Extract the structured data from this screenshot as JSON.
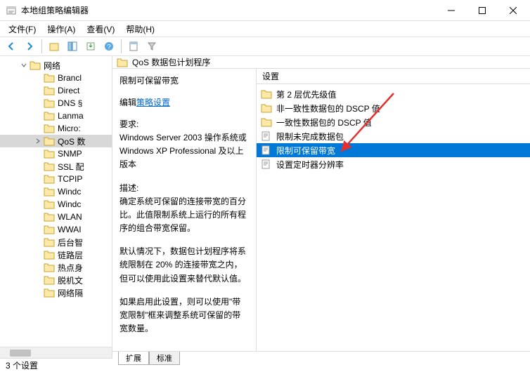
{
  "window": {
    "title": "本地组策略编辑器"
  },
  "menus": {
    "file": "文件(F)",
    "action": "操作(A)",
    "view": "查看(V)",
    "help": "帮助(H)"
  },
  "tree": {
    "root": "网络",
    "items": [
      "Brancl",
      "Direct",
      "DNS §",
      "Lanma",
      "Micro:",
      "QoS 数",
      "SNMP",
      "SSL 配",
      "TCPIP",
      "Windc",
      "Windc",
      "WLAN",
      "WWAI",
      "后台智",
      "链路层",
      "热点身",
      "脱机文",
      "网络隔"
    ],
    "selected_index": 5
  },
  "path": {
    "text": "QoS 数据包计划程序"
  },
  "description": {
    "setting_name": "限制可保留带宽",
    "edit_prefix": "编辑",
    "edit_link": "策略设置",
    "req_label": "要求:",
    "req_text": "Windows Server 2003 操作系统或 Windows XP Professional 及以上版本",
    "desc_label": "描述:",
    "desc_text1": "确定系统可保留的连接带宽的百分比。此值限制系统上运行的所有程序的组合带宽保留。",
    "desc_text2": "默认情况下，数据包计划程序将系统限制在 20% 的连接带宽之内，但可以使用此设置来替代默认值。",
    "desc_text3": "如果启用此设置，则可以使用\"带宽限制\"框来调整系统可保留的带宽数量。"
  },
  "list": {
    "header": "设置",
    "rows": [
      {
        "icon": "folder",
        "text": "第 2 层优先级值"
      },
      {
        "icon": "folder",
        "text": "非一致性数据包的 DSCP 值"
      },
      {
        "icon": "folder",
        "text": "一致性数据包的 DSCP 值"
      },
      {
        "icon": "policy",
        "text": "限制未完成数据包"
      },
      {
        "icon": "policy",
        "text": "限制可保留带宽"
      },
      {
        "icon": "policy",
        "text": "设置定时器分辨率"
      }
    ],
    "selected_index": 4
  },
  "tabs": {
    "extended": "扩展",
    "standard": "标准"
  },
  "status": {
    "text": "3 个设置"
  }
}
